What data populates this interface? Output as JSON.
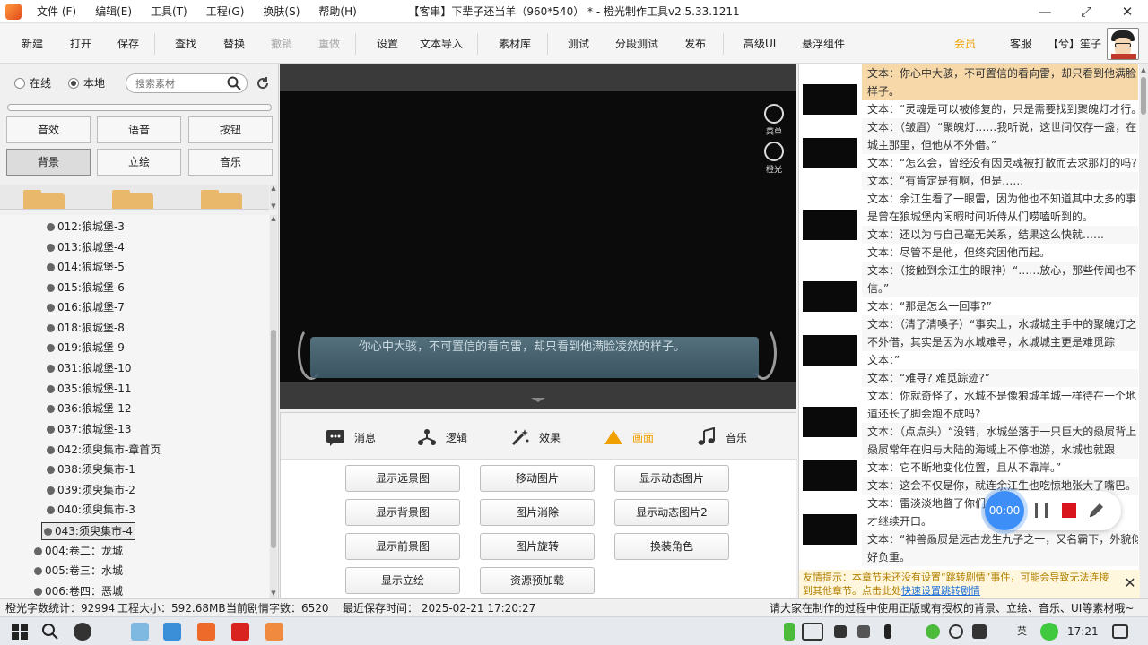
{
  "window": {
    "title": "【客串】下辈子还当羊（960*540） * - 橙光制作工具v2.5.33.1211",
    "menu": [
      "文件 (F)",
      "编辑(E)",
      "工具(T)",
      "工程(G)",
      "换肤(S)",
      "帮助(H)"
    ],
    "controls": [
      "—",
      "⤢",
      "✕"
    ]
  },
  "toolbar": {
    "new": "新建",
    "open": "打开",
    "save": "保存",
    "find": "查找",
    "replace": "替换",
    "undo": "撤销",
    "redo": "重做",
    "settings": "设置",
    "text_import": "文本导入",
    "assets": "素材库",
    "test": "测试",
    "segment_test": "分段测试",
    "publish": "发布",
    "advanced_ui": "高级UI",
    "floating": "悬浮组件",
    "notice": "会员",
    "service": "客服",
    "user": "【兮】笙子"
  },
  "left": {
    "radio_online": "在线",
    "radio_local": "本地",
    "search_placeholder": "搜索素材",
    "categories": [
      "音效",
      "语音",
      "按钮",
      "背景",
      "立绘",
      "音乐"
    ],
    "active_category": "背景",
    "tree": [
      "012:狼城堡-3",
      "013:狼城堡-4",
      "014:狼城堡-5",
      "015:狼城堡-6",
      "016:狼城堡-7",
      "018:狼城堡-8",
      "019:狼城堡-9",
      "031:狼城堡-10",
      "035:狼城堡-11",
      "036:狼城堡-12",
      "037:狼城堡-13",
      "042:须臾集市-章首页",
      "038:须臾集市-1",
      "039:须臾集市-2",
      "040:须臾集市-3",
      "043:须臾集市-4",
      "004:卷二：龙城",
      "005:卷三：水城",
      "006:卷四：恶城"
    ],
    "selected": "043:须臾集市-4"
  },
  "preview": {
    "dialog": "你心中大骇，不可置信的看向雷，却只看到他满脸凌然的样子。",
    "overlay_menu": "菜单",
    "overlay_orange": "橙光"
  },
  "commands": {
    "tabs": [
      "消息",
      "逻辑",
      "效果",
      "画面",
      "音乐"
    ],
    "active_tab": "画面",
    "buttons": [
      "显示远景图",
      "移动图片",
      "显示动态图片",
      "显示背景图",
      "图片消除",
      "显示动态图片2",
      "显示前景图",
      "图片旋转",
      "换装角色",
      "显示立绘",
      "资源预加载"
    ]
  },
  "script": {
    "lines": [
      "文本：你心中大骇，不可置信的看向雷，却只看到他满脸",
      "    样子。",
      "文本：“灵魂是可以被修复的，只是需要找到聚魄灯才行。",
      "文本：（皱眉）“聚魄灯……我听说，这世间仅存一盏，在",
      "    城主那里，但他从不外借。”",
      "文本：“怎么会，曾经没有因灵魂被打散而去求那灯的吗?",
      "文本：“有肯定是有啊，但是……",
      "文本：余江生看了一眼雷，因为他也不知道其中太多的事",
      "    是曾在狼城堡内闲暇时间听侍从们唠嗑听到的。",
      "文本：还以为与自己毫无关系，结果这么快就……",
      "文本：尽管不是他，但终究因他而起。",
      "文本：（接触到余江生的眼神）“……放心，那些传闻也不",
      "    信。”",
      "文本：“那是怎么一回事?”",
      "文本：（清了清嗓子）“事实上，水城城主手中的聚魄灯之",
      "    不外借，其实是因为水城难寻，水城城主更是难觅踪",
      "文本：”",
      "文本：“难寻? 难觅踪迹?”",
      "文本：你就奇怪了，水城不是像狼城羊城一样待在一个地",
      "    道还长了脚会跑不成吗?",
      "文本：（点点头）“没错，水城坐落于一只巨大的赑屃背上",
      "    赑屃常年在归与大陆的海域上不停地游，水城也就跟",
      "文本：它不断地变化位置，且从不靠岸。”",
      "文本：这会不仅是你，就连余江生也吃惊地张大了嘴巴。",
      "文本：雷淡淡地瞥了你们一眼，",
      "    才继续开口。",
      "文本：“神兽赑屃是远古龙生九子之一，又名霸下，外貌似",
      "    好负重。"
    ],
    "highlighted_index": 0,
    "tip_text": "友情提示：本章节未还没有设置“跳转剧情”事件，可能会导致无法连接到其他章节。点击此处",
    "tip_link": "快速设置跳转剧情"
  },
  "recorder": {
    "time": "00:00"
  },
  "status": {
    "word_count": "橙光字数统计：92994",
    "project_size": "工程大小：592.68MB",
    "scene_words": "当前剧情字数：6520",
    "last_save": "最近保存时间：    2025-02-21 17:20:27",
    "reminder": "请大家在制作的过程中使用正版或有授权的背景、立绘、音乐、UI等素材哦~"
  },
  "taskbar": {
    "time": "17:21",
    "tray_label": "英"
  },
  "colors": {
    "accent_orange": "#f0a000",
    "record_stop": "#d8141c",
    "record_time_bg": "#3e8ef7",
    "highlight_row": "#f7d8a8"
  }
}
